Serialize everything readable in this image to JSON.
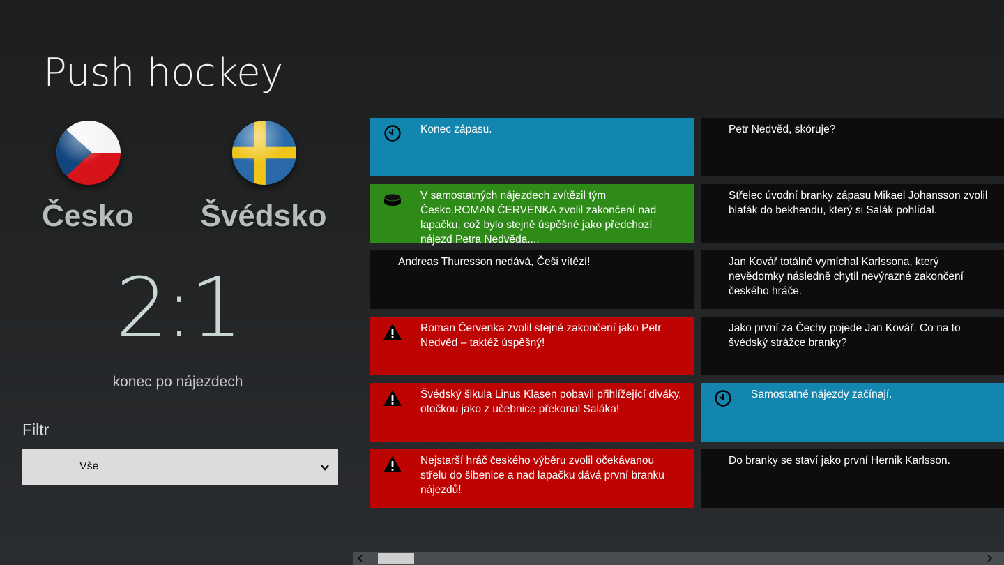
{
  "app": {
    "title": "Push hockey"
  },
  "match": {
    "home": {
      "name": "Česko",
      "flag_icon": "czech-flag-icon"
    },
    "away": {
      "name": "Švédsko",
      "flag_icon": "sweden-flag-icon"
    },
    "score": "2:1",
    "status": "konec po nájezdech"
  },
  "filter": {
    "label": "Filtr",
    "selected": "Vše"
  },
  "feed": {
    "column1": [
      {
        "type": "blue",
        "icon": "clock-icon",
        "text": "Konec zápasu."
      },
      {
        "type": "green",
        "icon": "puck-icon",
        "text": "V samostatných nájezdech zvítězil tým Česko.ROMAN ČERVENKA zvolil zakončení nad lapačku, což bylo stejně úspěšné jako předchozí nájezd Petra Nedvěda...."
      },
      {
        "type": "dark",
        "icon": "",
        "text": "Andreas Thuresson nedává, Češi vítězí!"
      },
      {
        "type": "red",
        "icon": "warning-icon",
        "text": "Roman Červenka zvolil stejné zakončení jako Petr Nedvěd – taktéž úspěšný!"
      },
      {
        "type": "red",
        "icon": "warning-icon",
        "text": "Švédský šikula Linus Klasen pobavil přihlížející diváky, otočkou jako z učebnice překonal Saláka!"
      },
      {
        "type": "red",
        "icon": "warning-icon",
        "text": "Nejstarší hráč českého výběru zvolil očekávanou střelu do šibenice a nad lapačku dává první branku nájezdů!"
      }
    ],
    "column2": [
      {
        "type": "dark",
        "icon": "",
        "text": "Petr Nedvěd, skóruje?"
      },
      {
        "type": "dark",
        "icon": "",
        "text": "Střelec úvodní branky zápasu Mikael Johansson zvolil blafák do bekhendu, který si Salák pohlídal."
      },
      {
        "type": "dark",
        "icon": "",
        "text": "Jan Kovář totálně vymíchal Karlssona, který nevědomky následně chytil nevýrazné zakončení českého hráče."
      },
      {
        "type": "dark",
        "icon": "",
        "text": "Jako první za Čechy pojede Jan Kovář. Co na to švédský strážce branky?"
      },
      {
        "type": "blue",
        "icon": "clock-icon",
        "text": "Samostatné nájezdy začínají."
      },
      {
        "type": "dark",
        "icon": "",
        "text": "Do branky se staví jako první Hernik Karlsson."
      }
    ]
  },
  "colors": {
    "blue": "#1386b0",
    "green": "#2f8b18",
    "red": "#be0303",
    "dark": "#0d0d0e"
  }
}
